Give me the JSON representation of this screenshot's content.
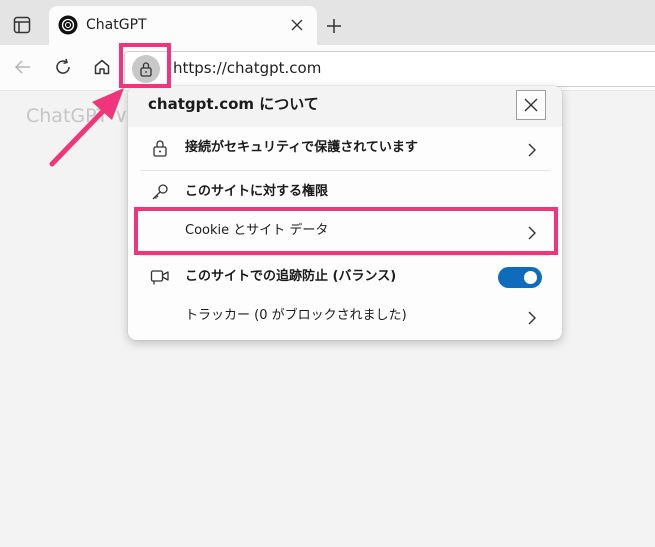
{
  "tab": {
    "title": "ChatGPT"
  },
  "address_bar": {
    "url": "https://chatgpt.com"
  },
  "page": {
    "heading": "ChatGPT ∨"
  },
  "site_info_flyout": {
    "title": "chatgpt.com について",
    "rows": {
      "connection": "接続がセキュリティで保護されています",
      "permissions": "このサイトに対する権限",
      "cookies": "Cookie とサイト データ",
      "tracking_prevention": "このサイトでの追跡防止 (バランス)",
      "trackers": "トラッカー (0 がブロックされました)"
    },
    "tracking_prevention_enabled": true
  },
  "colors": {
    "highlight": "#f0357a",
    "toggle_on": "#0f6cbd"
  },
  "icons": [
    "tab-actions-icon",
    "chatgpt-logo-icon",
    "close-icon",
    "plus-icon",
    "back-arrow-icon",
    "refresh-icon",
    "home-icon",
    "lock-icon",
    "chevron-right-icon",
    "key-icon",
    "camera-tracking-icon"
  ]
}
